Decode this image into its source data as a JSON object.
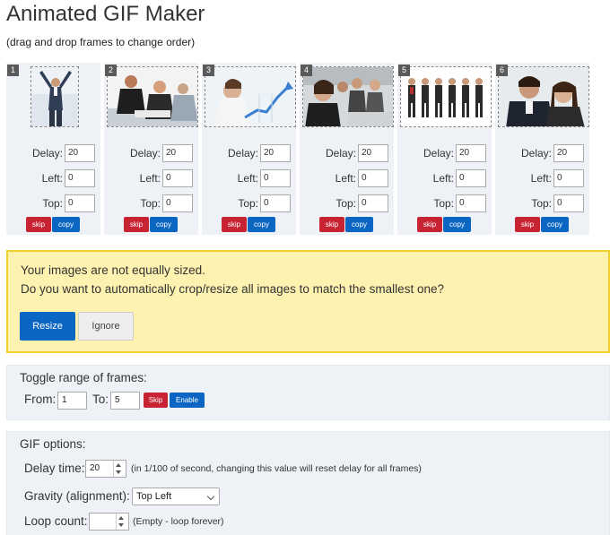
{
  "page": {
    "title": "Animated GIF Maker",
    "subtitle": "(drag and drop frames to change order)"
  },
  "frame_labels": {
    "delay": "Delay:",
    "left": "Left:",
    "top": "Top:",
    "skip": "skip",
    "copy": "copy"
  },
  "frames": [
    {
      "number": "1",
      "delay": "20",
      "left": "0",
      "top": "0"
    },
    {
      "number": "2",
      "delay": "20",
      "left": "0",
      "top": "0"
    },
    {
      "number": "3",
      "delay": "20",
      "left": "0",
      "top": "0"
    },
    {
      "number": "4",
      "delay": "20",
      "left": "0",
      "top": "0"
    },
    {
      "number": "5",
      "delay": "20",
      "left": "0",
      "top": "0"
    },
    {
      "number": "6",
      "delay": "20",
      "left": "0",
      "top": "0"
    }
  ],
  "alert": {
    "line1": "Your images are not equally sized.",
    "line2": "Do you want to automatically crop/resize all images to match the smallest one?",
    "resize_label": "Resize",
    "ignore_label": "Ignore",
    "background": "#fdf2b0",
    "border": "#f2cf2c"
  },
  "toggle_range": {
    "heading": "Toggle range of frames:",
    "from_label": "From:",
    "from_value": "1",
    "to_label": "To:",
    "to_value": "5",
    "skip_label": "Skip",
    "enable_label": "Enable"
  },
  "gif_options": {
    "heading": "GIF options:",
    "delay_label": "Delay time:",
    "delay_value": "20",
    "delay_note": "(in 1/100 of second, changing this value will reset delay for all frames)",
    "gravity_label": "Gravity (alignment):",
    "gravity_value": "Top Left",
    "loop_label": "Loop count:",
    "loop_value": "",
    "loop_note": "(Empty - loop forever)"
  },
  "colors": {
    "primary": "#0a66c2",
    "danger": "#c82333",
    "panel": "#eef2f7"
  },
  "icons": {
    "spinner": "number-spinner-icon",
    "dropdown": "chevron-down-icon"
  }
}
